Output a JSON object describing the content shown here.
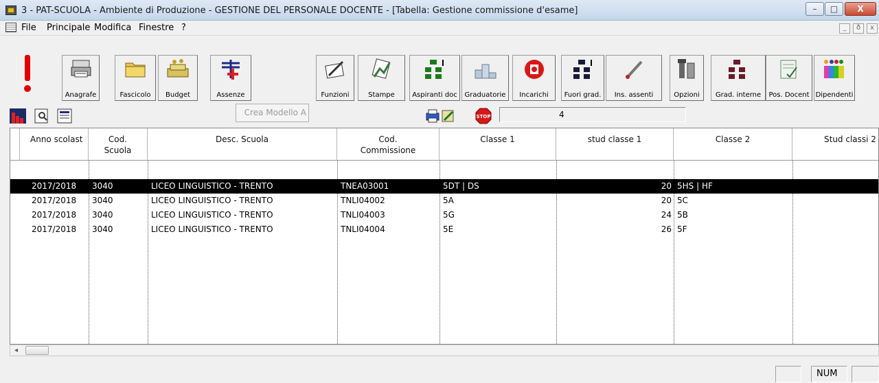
{
  "window": {
    "title": "3 - PAT-SCUOLA - Ambiente di Produzione - GESTIONE DEL PERSONALE DOCENTE - [Tabella: Gestione commissione d'esame]",
    "icon": "app-icon",
    "controls": {
      "minimize": "–",
      "maximize": "□",
      "close": "X"
    }
  },
  "menubar": {
    "items": [
      "File",
      "Principale",
      "Modifica",
      "Finestre",
      "?"
    ],
    "mdi_controls": {
      "minimize": "_",
      "restore": "ð",
      "close": "x"
    }
  },
  "toolbar": {
    "buttons": [
      {
        "label": "Anagrafe",
        "icon": "printer-icon"
      },
      {
        "label": "Fascicolo",
        "icon": "folder-icon"
      },
      {
        "label": "Budget",
        "icon": "money-icon"
      },
      {
        "label": "Assenze",
        "icon": "calendar-cross-icon"
      },
      {
        "label": "Funzioni",
        "icon": "pencil-document-icon"
      },
      {
        "label": "Stampe",
        "icon": "print-documents-icon"
      },
      {
        "label": "Aspiranti doc",
        "icon": "hierarchy-down-icon"
      },
      {
        "label": "Graduatorie",
        "icon": "podium-icon"
      },
      {
        "label": "Incarichi",
        "icon": "incarichi-icon"
      },
      {
        "label": "Fuori grad.",
        "icon": "hierarchy-up-icon"
      },
      {
        "label": "Ins. assenti",
        "icon": "thermometer-icon"
      },
      {
        "label": "Opzioni",
        "icon": "tools-icon"
      },
      {
        "label": "Grad. interne",
        "icon": "hierarchy-down-icon"
      },
      {
        "label": "Pos. Docent",
        "icon": "document-check-icon"
      },
      {
        "label": "Dipendenti",
        "icon": "people-group-icon"
      }
    ]
  },
  "subbar": {
    "crea_modello": "Crea Modello A",
    "record_count": "4"
  },
  "grid": {
    "columns": [
      "Anno scolast",
      "Cod.\nScuola",
      "Desc. Scuola",
      "Cod.\nCommissione",
      "Classe 1",
      "stud classe 1",
      "Classe 2",
      "Stud classi 2"
    ],
    "rows": [
      {
        "anno": "2017/2018",
        "cod_scuola": "3040",
        "desc": "LICEO LINGUISTICO - TRENTO",
        "cod_comm": "TNEA03001",
        "classe1": "5DT | DS",
        "stud1": "20",
        "classe2": "5HS | HF",
        "stud2": ""
      },
      {
        "anno": "2017/2018",
        "cod_scuola": "3040",
        "desc": "LICEO LINGUISTICO - TRENTO",
        "cod_comm": "TNLI04002",
        "classe1": "5A",
        "stud1": "20",
        "classe2": "5C",
        "stud2": ""
      },
      {
        "anno": "2017/2018",
        "cod_scuola": "3040",
        "desc": "LICEO LINGUISTICO - TRENTO",
        "cod_comm": "TNLI04003",
        "classe1": "5G",
        "stud1": "24",
        "classe2": "5B",
        "stud2": ""
      },
      {
        "anno": "2017/2018",
        "cod_scuola": "3040",
        "desc": "LICEO LINGUISTICO - TRENTO",
        "cod_comm": "TNLI04004",
        "classe1": "5E",
        "stud1": "26",
        "classe2": "5F",
        "stud2": ""
      }
    ]
  },
  "statusbar": {
    "num": "NUM"
  }
}
